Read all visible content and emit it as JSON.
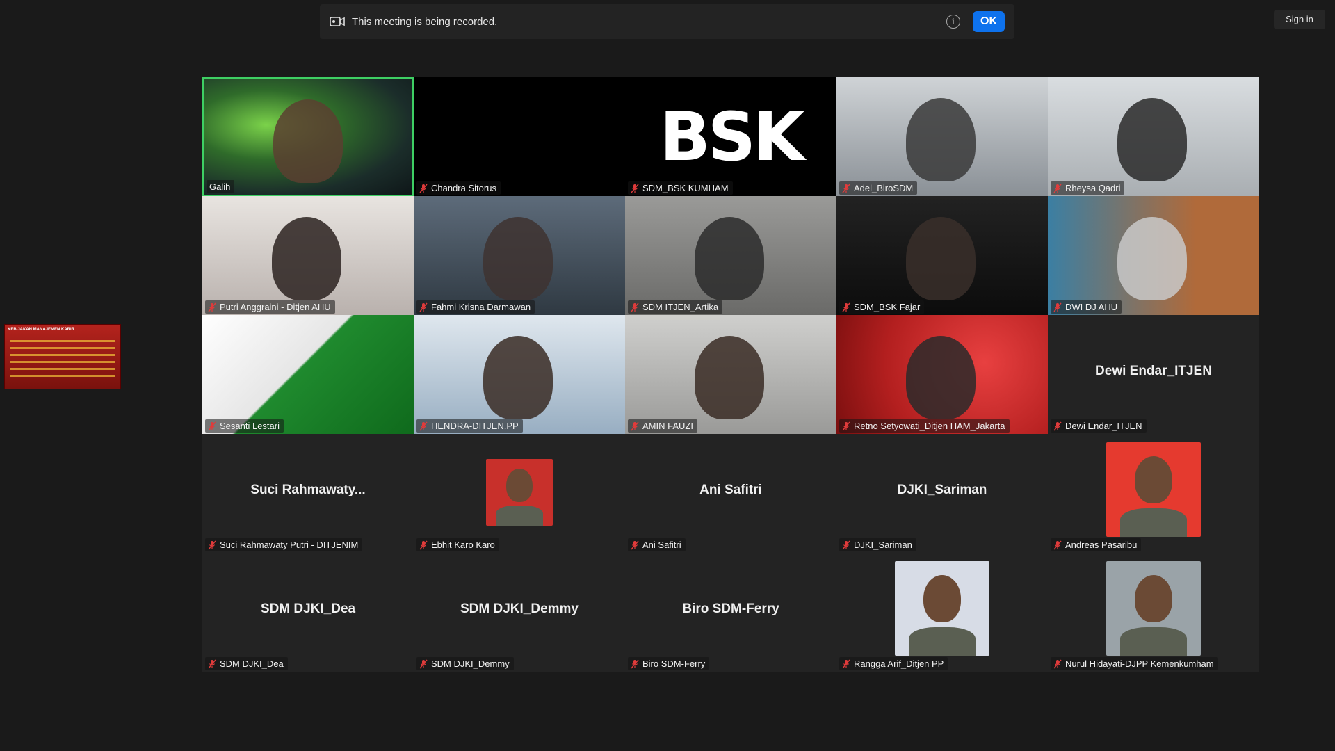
{
  "banner": {
    "message": "This meeting is being recorded.",
    "ok_label": "OK",
    "info_icon": "info-icon",
    "record_icon": "recording-icon"
  },
  "header": {
    "signin_label": "Sign in"
  },
  "share_thumbnail": {
    "caption": "KEBIJAKAN MANAJEMEN KARIR"
  },
  "colors": {
    "active_border": "#3ecf63",
    "ok_button": "#0e72ed",
    "muted_icon": "#e03b3b"
  },
  "participants": [
    {
      "name": "Galih",
      "kind": "video",
      "active": true,
      "muted": false
    },
    {
      "name": "Chandra Sitorus",
      "kind": "black",
      "muted": true
    },
    {
      "name": "SDM_BSK KUMHAM",
      "kind": "logo",
      "logo_text": "BSK",
      "muted": true
    },
    {
      "name": "Adel_BiroSDM",
      "kind": "video",
      "muted": true
    },
    {
      "name": "Rheysa Qadri",
      "kind": "video",
      "muted": true
    },
    {
      "name": "Putri Anggraini - Ditjen AHU",
      "kind": "video",
      "muted": true
    },
    {
      "name": "Fahmi Krisna Darmawan",
      "kind": "video",
      "muted": true
    },
    {
      "name": "SDM ITJEN_Artika",
      "kind": "video",
      "muted": true
    },
    {
      "name": "SDM_BSK Fajar",
      "kind": "video",
      "muted": true
    },
    {
      "name": "DWI DJ AHU",
      "kind": "video",
      "muted": true
    },
    {
      "name": "Sesanti Lestari",
      "kind": "video",
      "muted": true
    },
    {
      "name": "HENDRA-DITJEN.PP",
      "kind": "video",
      "muted": true
    },
    {
      "name": "AMIN FAUZI",
      "kind": "video",
      "muted": true
    },
    {
      "name": "Retno Setyowati_Ditjen HAM_Jakarta",
      "kind": "video",
      "muted": true
    },
    {
      "name": "Dewi Endar_ITJEN",
      "kind": "name",
      "display": "Dewi Endar_ITJEN",
      "muted": true
    },
    {
      "name": "Suci Rahmawaty Putri - DITJENIM",
      "kind": "name",
      "display": "Suci  Rahmawaty...",
      "muted": true
    },
    {
      "name": "Ebhit Karo Karo",
      "kind": "avatar",
      "muted": true
    },
    {
      "name": "Ani Safitri",
      "kind": "name",
      "display": "Ani Safitri",
      "muted": true
    },
    {
      "name": "DJKI_Sariman",
      "kind": "name",
      "display": "DJKI_Sariman",
      "muted": true
    },
    {
      "name": "Andreas Pasaribu",
      "kind": "avatar",
      "muted": true
    },
    {
      "name": "SDM DJKI_Dea",
      "kind": "name",
      "display": "SDM DJKI_Dea",
      "muted": true
    },
    {
      "name": "SDM DJKI_Demmy",
      "kind": "name",
      "display": "SDM DJKI_Demmy",
      "muted": true
    },
    {
      "name": "Biro SDM-Ferry",
      "kind": "name",
      "display": "Biro SDM-Ferry",
      "muted": true
    },
    {
      "name": "Rangga Arif_Ditjen PP",
      "kind": "avatar",
      "muted": true
    },
    {
      "name": "Nurul Hidayati-DJPP Kemenkumham",
      "kind": "avatar",
      "muted": true
    }
  ]
}
